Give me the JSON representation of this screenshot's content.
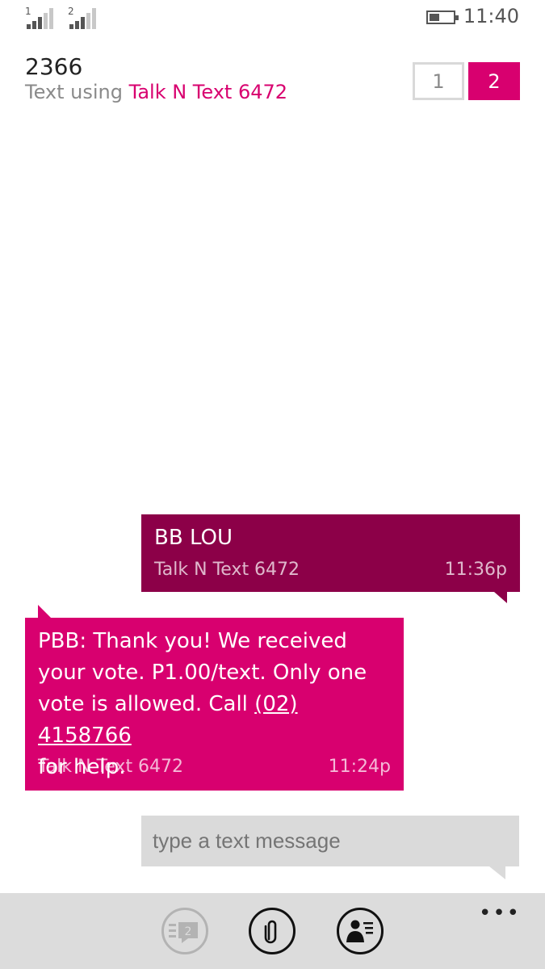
{
  "status_bar": {
    "sim1_label": "1",
    "sim2_label": "2",
    "time": "11:40"
  },
  "header": {
    "contact": "2366",
    "sub_prefix": "Text using ",
    "sub_sim": "Talk N Text 6472"
  },
  "sim_switch": {
    "sim1": "1",
    "sim2": "2",
    "active": "2"
  },
  "messages": [
    {
      "direction": "sent",
      "text": "BB LOU",
      "sim": "Talk N Text 6472",
      "time": "11:36p"
    },
    {
      "direction": "received",
      "text_line1": "PBB: Thank you! We received",
      "text_line2": "your vote. P1.00/text. Only one",
      "text_line3_prefix": "vote is allowed. Call ",
      "phone_link": "(02) 4158766",
      "text_line4": "for help.",
      "sim": "Talk N Text 6472",
      "time": "11:24p"
    }
  ],
  "compose": {
    "placeholder": "type a text message"
  },
  "app_bar": {
    "send_badge": "2",
    "more": "•••"
  },
  "colors": {
    "accent": "#d8006f",
    "sent_bubble": "#8c0048",
    "app_bar_bg": "#dcdcdc"
  }
}
